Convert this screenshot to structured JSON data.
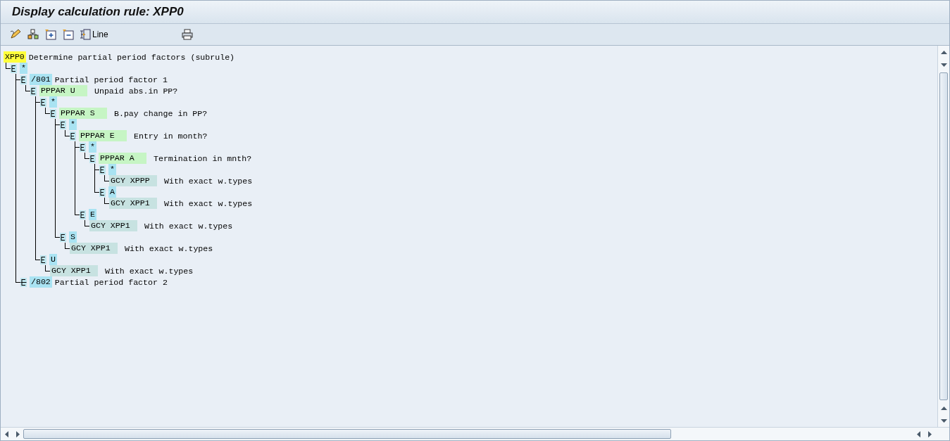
{
  "window": {
    "title": "Display calculation rule: XPP0"
  },
  "toolbar": {
    "line_button": "Line"
  },
  "tree": {
    "kind": "rule",
    "key": "XPP0",
    "text": "Determine partial period factors (subrule)",
    "children": [
      {
        "kind": "value",
        "key": "*",
        "expanded": true,
        "children": [
          {
            "kind": "value",
            "key": "/801",
            "text": "Partial period factor 1",
            "expanded": true,
            "children": [
              {
                "kind": "decision",
                "key": "PPPAR U",
                "text": "Unpaid abs.in PP?",
                "expanded": true,
                "children": [
                  {
                    "kind": "value",
                    "key": "*",
                    "expanded": true,
                    "children": [
                      {
                        "kind": "decision",
                        "key": "PPPAR S",
                        "text": "B.pay change in PP?",
                        "expanded": true,
                        "children": [
                          {
                            "kind": "value",
                            "key": "*",
                            "expanded": true,
                            "children": [
                              {
                                "kind": "decision",
                                "key": "PPPAR E",
                                "text": "Entry in month?",
                                "expanded": true,
                                "children": [
                                  {
                                    "kind": "value",
                                    "key": "*",
                                    "expanded": true,
                                    "children": [
                                      {
                                        "kind": "decision",
                                        "key": "PPPAR A",
                                        "text": "Termination in mnth?",
                                        "expanded": true,
                                        "children": [
                                          {
                                            "kind": "value",
                                            "key": "*",
                                            "expanded": true,
                                            "children": [
                                              {
                                                "kind": "operation",
                                                "key": "GCY XPPP",
                                                "text": "With exact w.types"
                                              }
                                            ]
                                          },
                                          {
                                            "kind": "value",
                                            "key": "A",
                                            "expanded": true,
                                            "children": [
                                              {
                                                "kind": "operation",
                                                "key": "GCY XPP1",
                                                "text": "With exact w.types"
                                              }
                                            ]
                                          }
                                        ]
                                      }
                                    ]
                                  },
                                  {
                                    "kind": "value",
                                    "key": "E",
                                    "expanded": true,
                                    "children": [
                                      {
                                        "kind": "operation",
                                        "key": "GCY XPP1",
                                        "text": "With exact w.types"
                                      }
                                    ]
                                  }
                                ]
                              }
                            ]
                          },
                          {
                            "kind": "value",
                            "key": "S",
                            "expanded": true,
                            "children": [
                              {
                                "kind": "operation",
                                "key": "GCY XPP1",
                                "text": "With exact w.types"
                              }
                            ]
                          }
                        ]
                      }
                    ]
                  },
                  {
                    "kind": "value",
                    "key": "U",
                    "expanded": true,
                    "children": [
                      {
                        "kind": "operation",
                        "key": "GCY XPP1",
                        "text": "With exact w.types"
                      }
                    ]
                  }
                ]
              }
            ]
          },
          {
            "kind": "value",
            "key": "/802",
            "text": "Partial period factor 2",
            "expanded": false
          }
        ]
      }
    ]
  }
}
